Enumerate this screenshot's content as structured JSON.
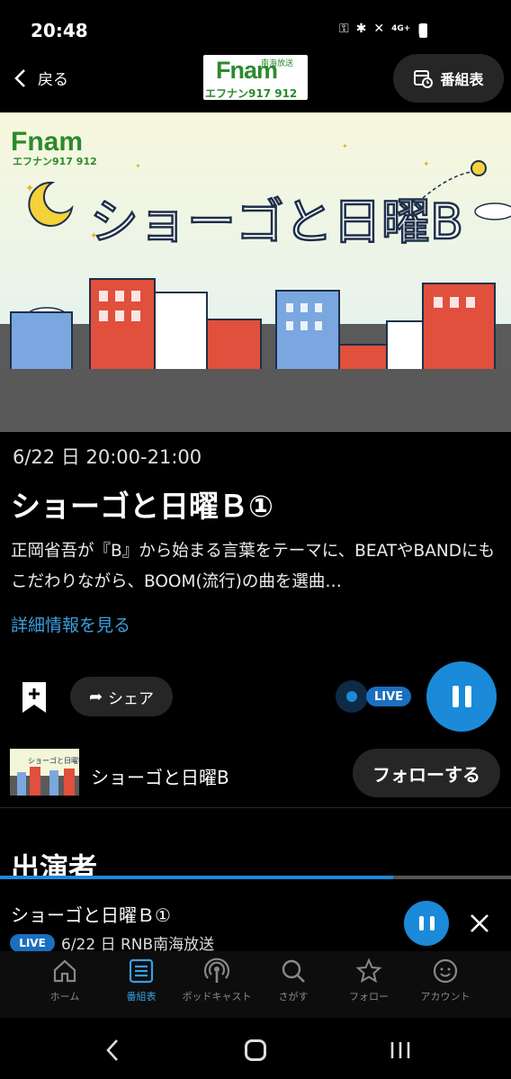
{
  "status_bar": {
    "time": "20:48",
    "network": "4G+"
  },
  "header": {
    "back_label": "戻る",
    "logo_main": "Fnam",
    "logo_sub": "エフナン917 912",
    "logo_top": "南海放送",
    "schedule_label": "番組表"
  },
  "hero": {
    "title": "ショーゴと日曜B",
    "logo_main": "Fnam",
    "logo_sub": "エフナン917 912"
  },
  "program": {
    "datetime": "6/22 日 20:00-21:00",
    "title": "ショーゴと日曜Ｂ①",
    "description": "正岡省吾が『B』から始まる言葉をテーマに、BEATやBANDにもこだわりながら、BOOM(流行)の曲を選曲…",
    "more_label": "詳細情報を見る"
  },
  "actions": {
    "share_label": "シェア",
    "live_label": "LIVE"
  },
  "program_row": {
    "name": "ショーゴと日曜B",
    "follow_label": "フォローする"
  },
  "section": {
    "cast_title": "出演者"
  },
  "mini_player": {
    "title": "ショーゴと日曜Ｂ①",
    "live_label": "LIVE",
    "subtitle": "6/22 日 RNB南海放送",
    "progress": 0.77
  },
  "bottom_nav": {
    "items": [
      {
        "label": "ホーム",
        "icon": "home-icon"
      },
      {
        "label": "番組表",
        "icon": "schedule-icon",
        "active": true
      },
      {
        "label": "ポッドキャスト",
        "icon": "podcast-icon"
      },
      {
        "label": "さがす",
        "icon": "search-icon"
      },
      {
        "label": "フォロー",
        "icon": "star-icon"
      },
      {
        "label": "アカウント",
        "icon": "account-icon"
      }
    ]
  },
  "colors": {
    "accent": "#1b8ad8",
    "link": "#3a9fe0",
    "logo_green": "#2d8a2d",
    "hero_sky": "#f4f6d8"
  }
}
